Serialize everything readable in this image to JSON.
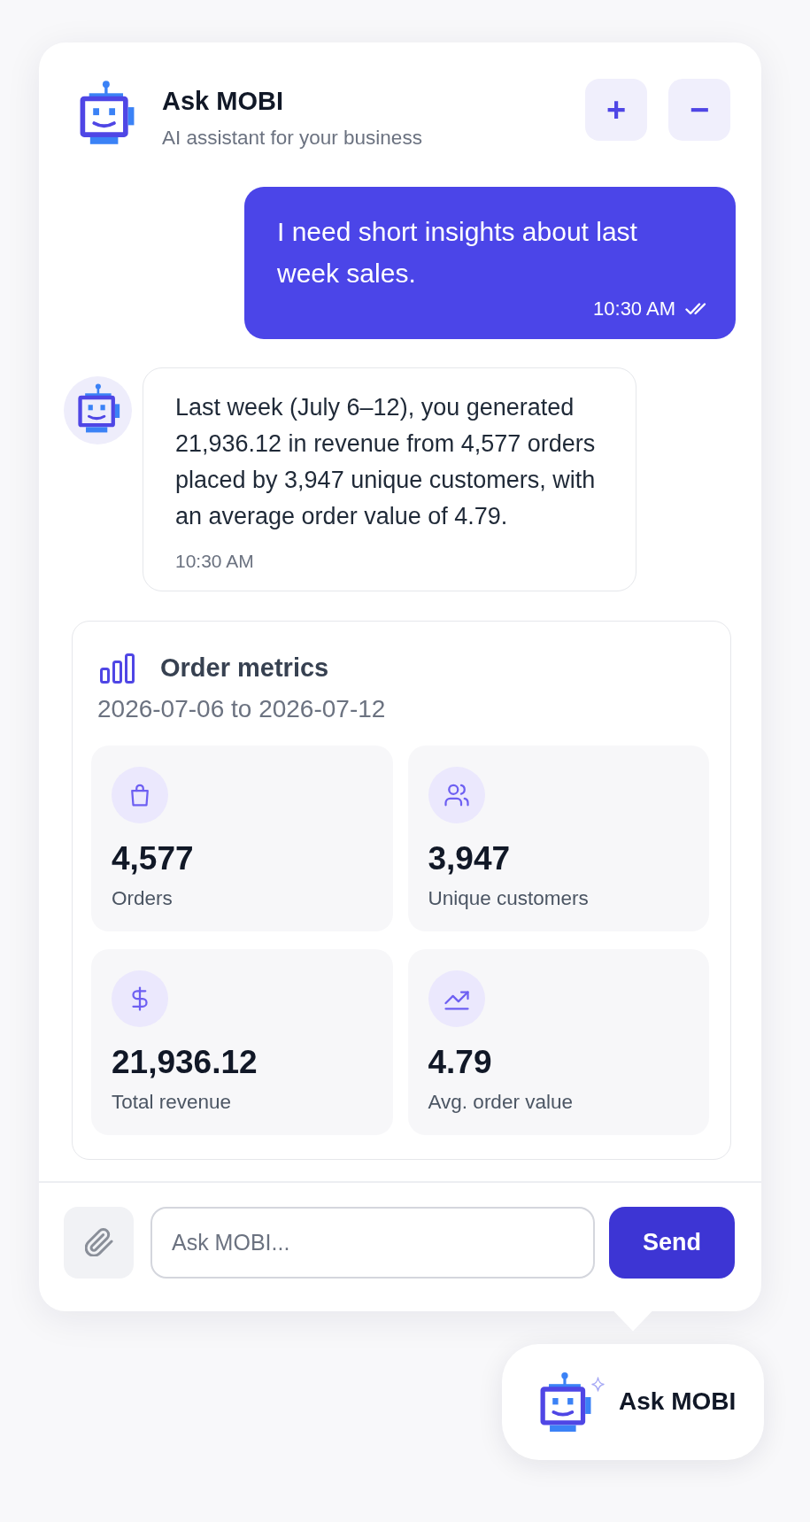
{
  "header": {
    "title": "Ask MOBI",
    "subtitle": "AI assistant for your business",
    "buttons": [
      {
        "label": "+"
      },
      {
        "label": "−"
      }
    ]
  },
  "messages": [
    {
      "kind": "user",
      "text": "I need short insights about last week sales.",
      "time": "10:30 AM",
      "read": true
    },
    {
      "kind": "bot",
      "text": "Last week (July 6–12), you generated 21,936.12 in revenue from 4,577 orders placed by 3,947 unique customers, with an average order value of 4.79.",
      "time": "10:30 AM"
    }
  ],
  "metrics_card": {
    "title": "Order metrics",
    "date_range": "2026-07-06 to 2026-07-12",
    "tiles": [
      {
        "kind": "orders",
        "value": "4,577",
        "label": "Orders"
      },
      {
        "kind": "customers",
        "value": "3,947",
        "label": "Unique customers"
      },
      {
        "kind": "revenue",
        "value": "21,936.12",
        "label": "Total revenue"
      },
      {
        "kind": "average",
        "value": "4.79",
        "label": "Avg. order value"
      }
    ]
  },
  "composer": {
    "placeholder": "Ask MOBI...",
    "send_label": "Send"
  },
  "launcher": {
    "label": "Ask MOBI"
  }
}
